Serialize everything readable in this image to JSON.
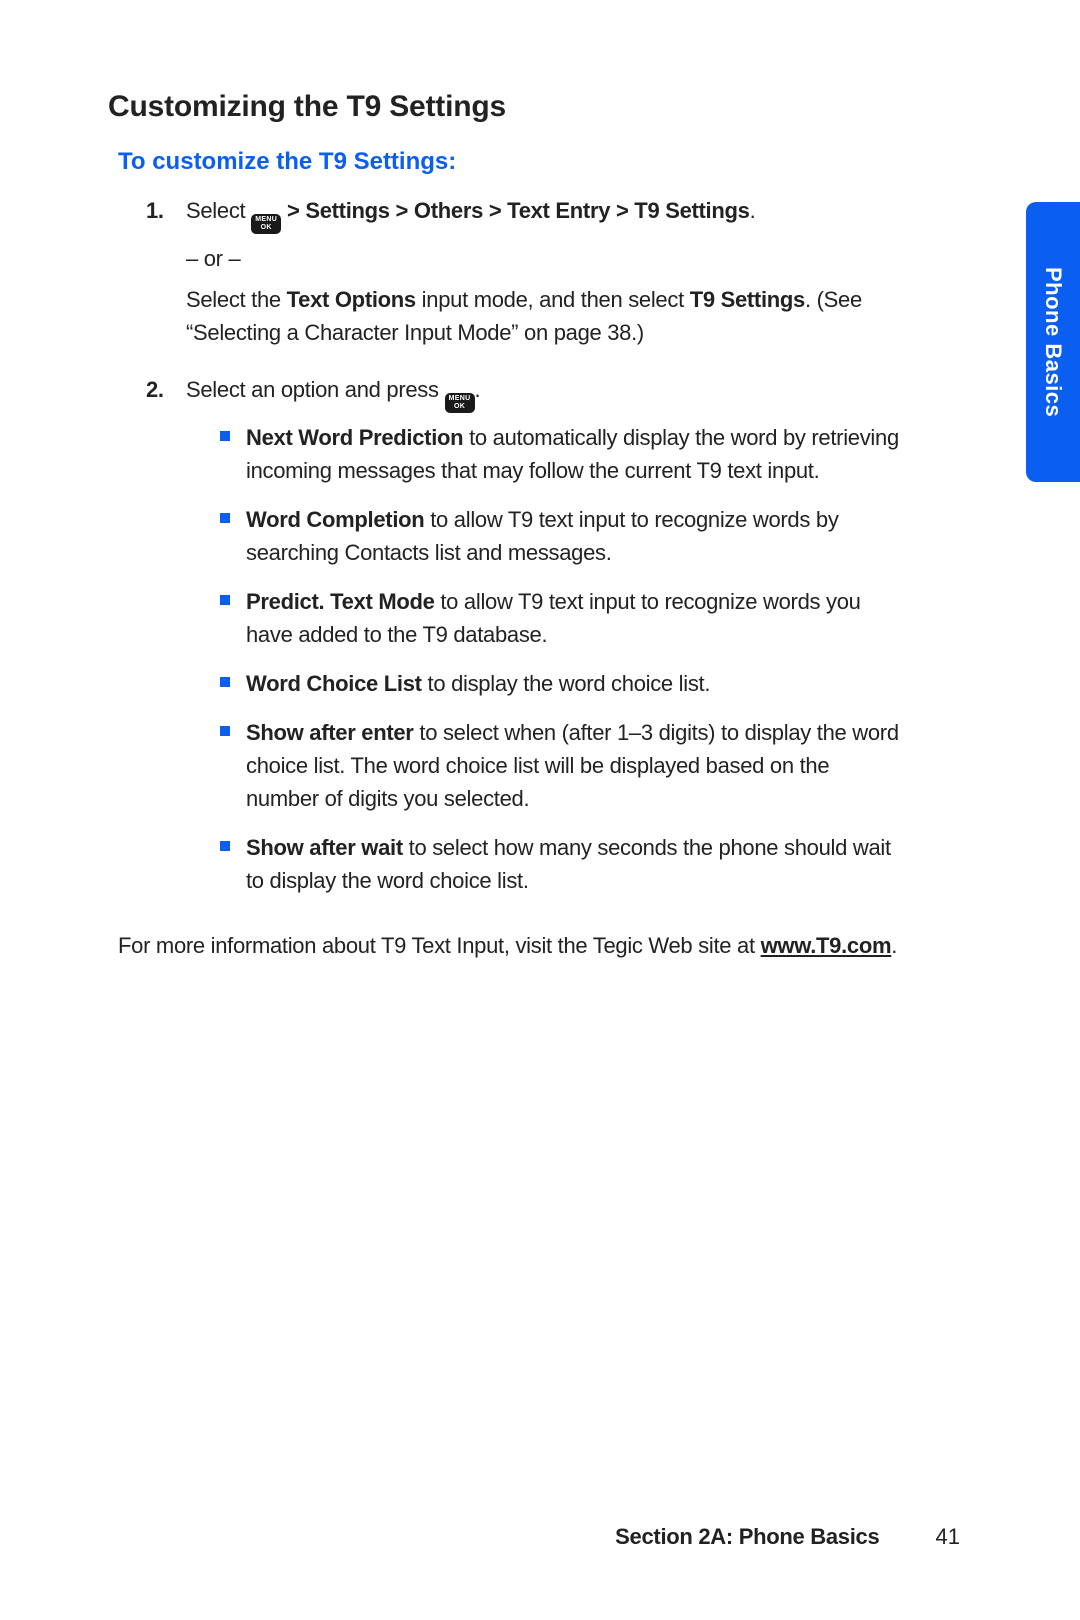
{
  "tab": {
    "label": "Phone Basics"
  },
  "heading": "Customizing the T9 Settings",
  "subheading": "To customize the T9 Settings:",
  "menu_key": {
    "line1": "MENU",
    "line2": "OK"
  },
  "steps": {
    "s1": {
      "num": "1.",
      "p1_a": "Select ",
      "p1_b": " > Settings > Others > Text Entry > T9 Settings",
      "p1_c": ".",
      "or": "– or –",
      "p2_a": "Select the ",
      "p2_b": "Text Options",
      "p2_c": " input mode, and then select ",
      "p2_d": "T9 Settings",
      "p2_e": ". (See “Selecting a Character Input Mode” on page 38.)"
    },
    "s2": {
      "num": "2.",
      "p1_a": "Select an option and press ",
      "p1_b": ".",
      "bullets": [
        {
          "bold": "Next Word Prediction",
          "rest": " to automatically display the word by retrieving incoming messages that may follow the current T9 text input."
        },
        {
          "bold": "Word Completion",
          "rest": " to allow T9 text input to recognize words by searching Contacts list and messages."
        },
        {
          "bold": "Predict. Text Mode",
          "rest": " to allow T9 text input to recognize words you have added to the T9 database."
        },
        {
          "bold": "Word Choice List",
          "rest": " to display the word choice list."
        },
        {
          "bold": "Show after enter",
          "rest": " to select when (after 1–3 digits) to display the word choice list. The word choice list will be displayed based on the number of digits you selected."
        },
        {
          "bold": "Show after wait",
          "rest": " to select how many seconds the phone should wait to display the word choice list."
        }
      ]
    }
  },
  "more_info": {
    "text": "For more information about T9 Text Input, visit the Tegic Web site at ",
    "link": "www.T9.com",
    "after": "."
  },
  "footer": {
    "section": "Section 2A: Phone Basics",
    "page": "41"
  }
}
